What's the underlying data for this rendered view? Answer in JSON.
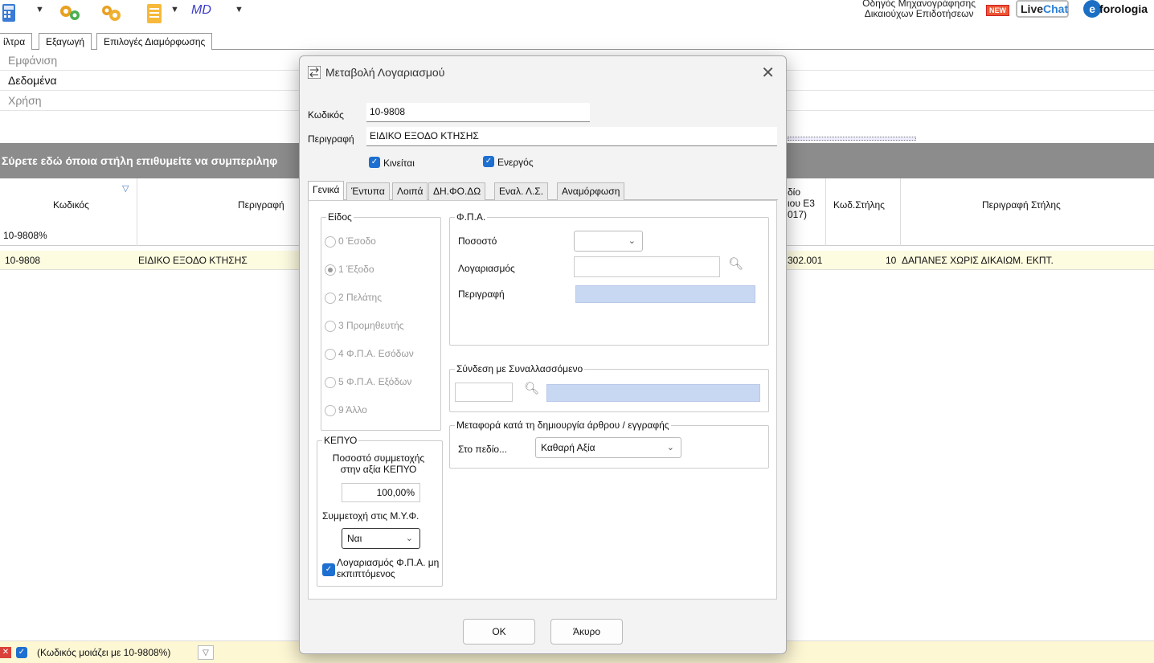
{
  "toolbar": {
    "md_label": "MD",
    "guide_line1": "Οδηγός Μηχανογράφησης",
    "guide_line2": "Δικαιούχων Επιδοτήσεων",
    "new_badge": "NEW",
    "livechat_live": "Live",
    "livechat_chat": "Chat",
    "eforologia_e": "e",
    "eforologia_rest": "forologia"
  },
  "top_tabs": [
    "ίλτρα",
    "Εξαγωγή",
    "Επιλογές Διαμόρφωσης"
  ],
  "menu": [
    "Εμφάνιση",
    "Δεδομένα",
    "Χρήση"
  ],
  "group_panel_text": "Σύρετε εδώ όποια στήλη επιθυμείτε να συμπεριληφ",
  "grid": {
    "headers": {
      "code": "Κωδικός",
      "descr": "Περιγραφή",
      "field_line1": "δίο",
      "field_line2": "ιου Ε3",
      "field_line3": "017)",
      "col_code": "Κωδ.Στήλης",
      "col_descr": "Περιγραφή Στήλης"
    },
    "filter_value": "10-9808%",
    "row": {
      "code": "10-9808",
      "descr": "ΕΙΔΙΚΟ ΕΞΟΔΟ ΚΤΗΣΗΣ",
      "field": "302.001",
      "col_code": "10",
      "col_descr": "ΔΑΠΑΝΕΣ ΧΩΡΙΣ ΔΙΚΑΙΩΜ. ΕΚΠΤ."
    }
  },
  "status": {
    "filter_text": "(Κωδικός μοιάζει με 10-9808%)"
  },
  "dialog": {
    "title": "Μεταβολή Λογαριασμού",
    "code_label": "Κωδικός",
    "code_value": "10-9808",
    "descr_label": "Περιγραφή",
    "descr_value": "ΕΙΔΙΚΟ ΕΞΟΔΟ ΚΤΗΣΗΣ",
    "moves_label": "Κινείται",
    "active_label": "Ενεργός",
    "tabs": [
      "Γενικά",
      "Έντυπα",
      "Λοιπά",
      "ΔΗ.ΦΟ.ΔΩ",
      "Εναλ. Λ.Σ.",
      "Αναμόρφωση"
    ],
    "kind_title": "Είδος",
    "kinds": [
      "0 Έσοδο",
      "1 Έξοδο",
      "2 Πελάτης",
      "3 Προμηθευτής",
      "4 Φ.Π.Α. Εσόδων",
      "5 Φ.Π.Α. Εξόδων",
      "9 Άλλο"
    ],
    "kepyo_title": "ΚΕΠΥΟ",
    "kepyo_pct_label": "Ποσοστό συμμετοχής στην αξία ΚΕΠΥΟ",
    "kepyo_pct_value": "100,00%",
    "myf_label": "Συμμετοχή στις Μ.Υ.Φ.",
    "myf_value": "Ναι",
    "vat_nondeduct_label": "Λογαριασμός Φ.Π.Α. μη εκπιπτόμενος",
    "vat_title": "Φ.Π.Α.",
    "vat_pct_label": "Ποσοστό",
    "vat_account_label": "Λογαριασμός",
    "vat_descr_label": "Περιγραφή",
    "link_title": "Σύνδεση με Συναλλασσόμενο",
    "transfer_title": "Μεταφορά κατά τη δημιουργία άρθρου / εγγραφής",
    "transfer_field_label": "Στο πεδίο...",
    "transfer_field_value": "Καθαρή Αξία",
    "ok_label": "OK",
    "cancel_label": "Άκυρο"
  }
}
